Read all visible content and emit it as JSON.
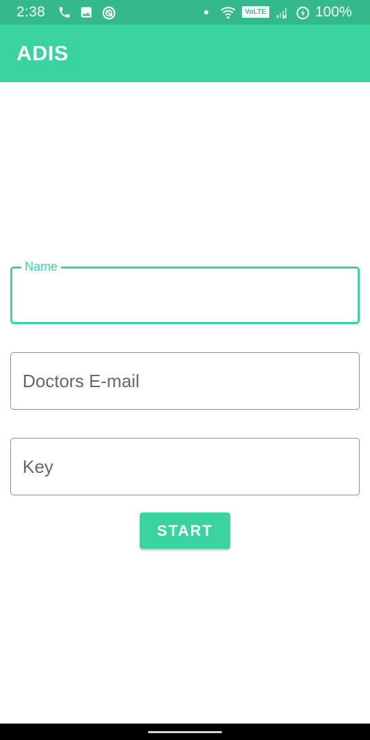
{
  "status_bar": {
    "time": "2:38",
    "volte_label": "VoLTE",
    "battery_percent": "100%",
    "icons": [
      "phone-call-icon",
      "gallery-icon",
      "app-notification-icon",
      "wifi-icon",
      "signal-icon",
      "battery-saver-icon"
    ]
  },
  "app_bar": {
    "title": "ADIS"
  },
  "form": {
    "name_field": {
      "label": "Name",
      "value": ""
    },
    "email_field": {
      "placeholder": "Doctors E-mail",
      "value": ""
    },
    "key_field": {
      "placeholder": "Key",
      "value": ""
    },
    "start_label": "START"
  },
  "colors": {
    "status_bar": "#33B98A",
    "accent": "#3AD39F",
    "field_border": "#8f8f8f",
    "placeholder": "#666666"
  }
}
